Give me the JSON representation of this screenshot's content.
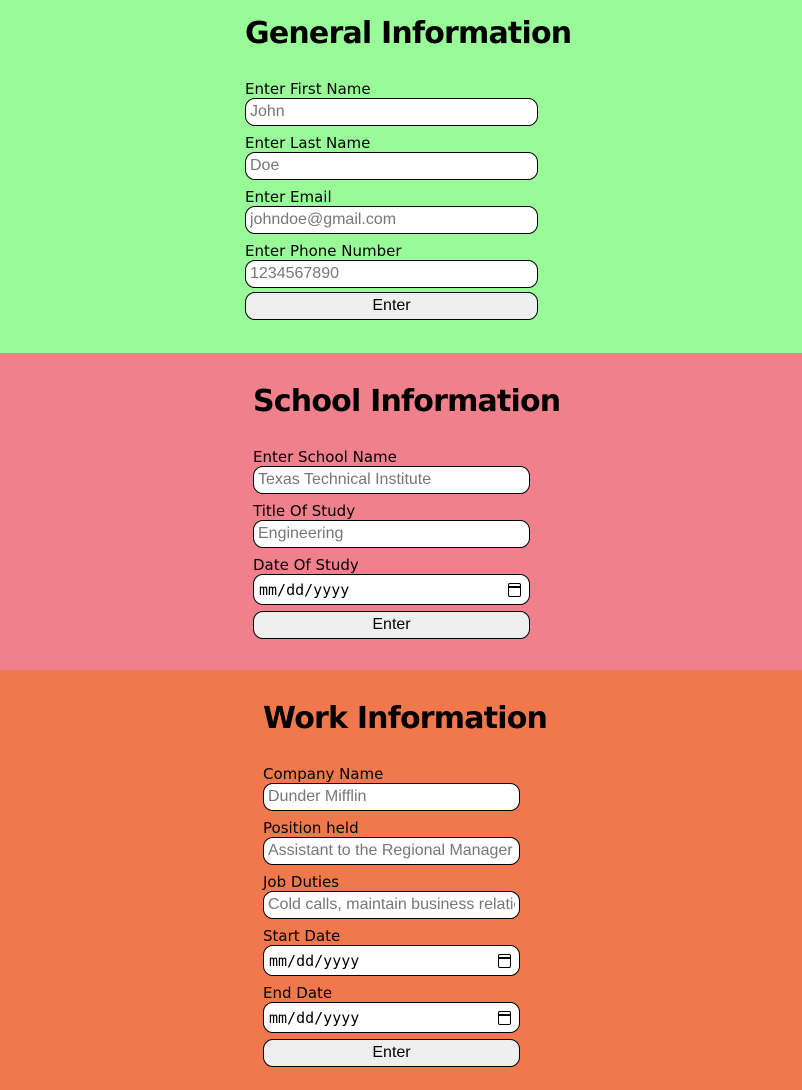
{
  "general": {
    "title": "General Information",
    "first_name": {
      "label": "Enter First Name",
      "placeholder": "John"
    },
    "last_name": {
      "label": "Enter Last Name",
      "placeholder": "Doe"
    },
    "email": {
      "label": "Enter Email",
      "placeholder": "johndoe@gmail.com"
    },
    "phone": {
      "label": "Enter Phone Number",
      "placeholder": "1234567890"
    },
    "submit_label": "Enter",
    "bg_color": "#98fb98"
  },
  "school": {
    "title": "School Information",
    "school_name": {
      "label": "Enter School Name",
      "placeholder": "Texas Technical Institute"
    },
    "title_of_study": {
      "label": "Title Of Study",
      "placeholder": "Engineering"
    },
    "date_of_study": {
      "label": "Date Of Study",
      "placeholder": "mm/dd/yyyy",
      "icon": "calendar-icon"
    },
    "submit_label": "Enter",
    "bg_color": "#f0808c"
  },
  "work": {
    "title": "Work Information",
    "company_name": {
      "label": "Company Name",
      "placeholder": "Dunder Mifflin"
    },
    "position": {
      "label": "Position held",
      "placeholder": "Assistant to the Regional Manager"
    },
    "duties": {
      "label": "Job Duties",
      "placeholder": "Cold calls, maintain business relationships"
    },
    "start_date": {
      "label": "Start Date",
      "placeholder": "mm/dd/yyyy",
      "icon": "calendar-icon"
    },
    "end_date": {
      "label": "End Date",
      "placeholder": "mm/dd/yyyy",
      "icon": "calendar-icon"
    },
    "submit_label": "Enter",
    "bg_color": "#f0784c"
  }
}
